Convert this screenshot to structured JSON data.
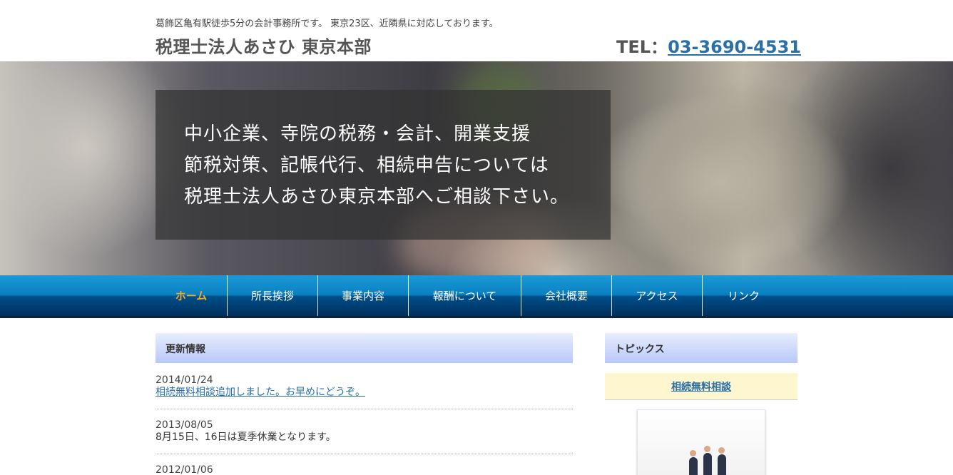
{
  "header": {
    "tagline": "葛飾区亀有駅徒歩5分の会計事務所です。 東京23区、近隣県に対応しております。",
    "site_title": "税理士法人あさひ 東京本部",
    "tel_label": "TEL：",
    "tel_number": "03-3690-4531"
  },
  "hero": {
    "lines": [
      "中小企業、寺院の税務・会計、開業支援",
      "節税対策、記帳代行、相続申告については",
      "税理士法人あさひ東京本部へご相談下さい。"
    ]
  },
  "nav": {
    "items": [
      {
        "label": "ホーム",
        "active": true
      },
      {
        "label": "所長挨拶"
      },
      {
        "label": "事業内容"
      },
      {
        "label": "報酬について"
      },
      {
        "label": "会社概要"
      },
      {
        "label": "アクセス"
      },
      {
        "label": "リンク"
      }
    ]
  },
  "main": {
    "heading": "更新情報",
    "news": [
      {
        "date": "2014/01/24",
        "text": "相続無料相談追加しました。お早めにどうぞ。",
        "link": true
      },
      {
        "date": "2013/08/05",
        "text": "8月15日、16日は夏季休業となります。",
        "link": false
      },
      {
        "date": "2012/01/06",
        "text": "",
        "link": false
      }
    ]
  },
  "side": {
    "heading": "トピックス",
    "link_label": "相続無料相談"
  },
  "colors": {
    "nav_active": "#f5a623",
    "link": "#2a6fa8",
    "section_head": "#b8c8f8",
    "topic_bg": "#fdf6cf"
  }
}
